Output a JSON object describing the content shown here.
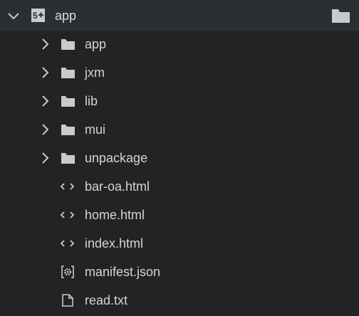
{
  "root": {
    "label": "app",
    "icons": [
      "chevron-down-icon",
      "project-5plus-icon",
      "folder-icon"
    ]
  },
  "items": [
    {
      "label": "app",
      "type": "folder",
      "icon": "folder-icon"
    },
    {
      "label": "jxm",
      "type": "folder",
      "icon": "folder-icon"
    },
    {
      "label": "lib",
      "type": "folder",
      "icon": "folder-icon"
    },
    {
      "label": "mui",
      "type": "folder",
      "icon": "folder-icon"
    },
    {
      "label": "unpackage",
      "type": "folder",
      "icon": "folder-icon"
    },
    {
      "label": "bar-oa.html",
      "type": "html",
      "icon": "code-brackets-icon"
    },
    {
      "label": "home.html",
      "type": "html",
      "icon": "code-brackets-icon"
    },
    {
      "label": "index.html",
      "type": "html",
      "icon": "code-brackets-icon"
    },
    {
      "label": "manifest.json",
      "type": "json",
      "icon": "gear-file-icon"
    },
    {
      "label": "read.txt",
      "type": "txt",
      "icon": "file-icon"
    }
  ],
  "colors": {
    "background": "#212325",
    "root_row_background": "#2c2f32",
    "text": "#d2d4d6",
    "icon": "#c8cacc"
  }
}
